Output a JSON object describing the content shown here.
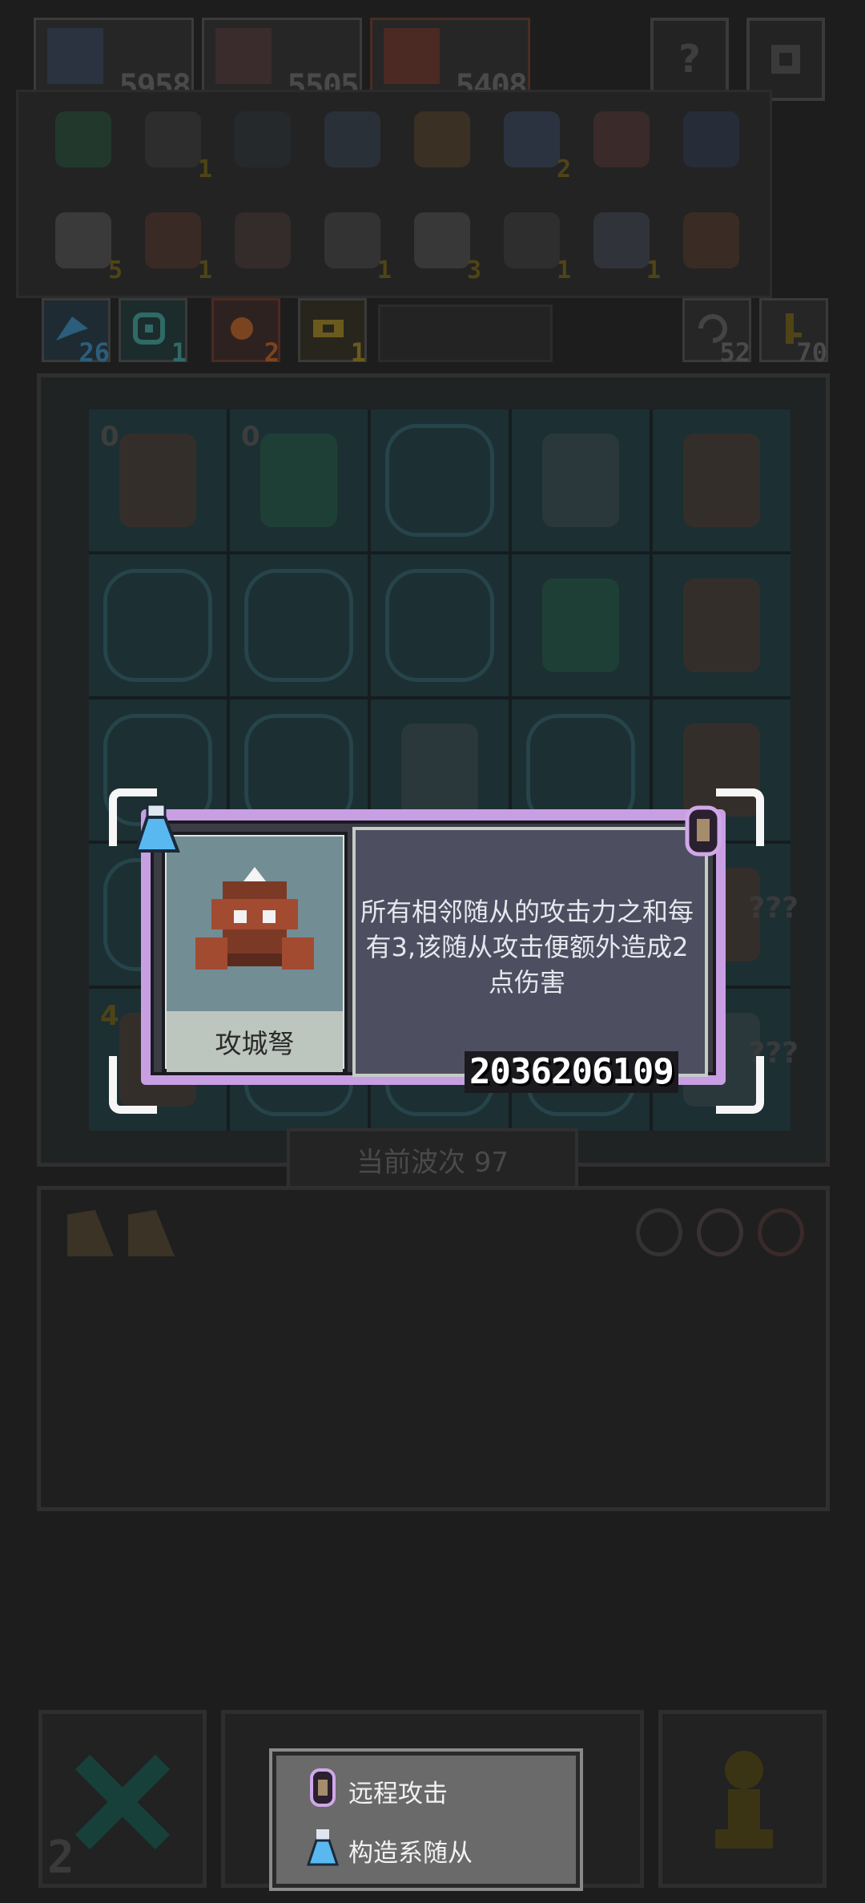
{
  "top_bar": {
    "players": [
      {
        "score": "5958",
        "icon": "griffin-portrait"
      },
      {
        "score": "5505",
        "icon": "knight-portrait"
      },
      {
        "score": "5408",
        "icon": "dragon-portrait"
      }
    ],
    "help_label": "?",
    "settings_icon": "gear-icon"
  },
  "tags": [
    {
      "icon": "wing-tag-icon",
      "count": "26",
      "color": "#2b5e7a"
    },
    {
      "icon": "eye-tag-icon",
      "count": "1",
      "color": "#2f6a66"
    },
    {
      "icon": "sun-tag-icon",
      "count": "2",
      "color": "#7a4420"
    },
    {
      "icon": "tape-tag-icon",
      "count": "1",
      "color": "#6a5a1e"
    }
  ],
  "counters": {
    "refresh": "52",
    "key": "70"
  },
  "board": {
    "cell_badges": [
      "0",
      "0",
      "4"
    ],
    "question_marks": "???"
  },
  "wave": {
    "label": "当前波次 97"
  },
  "inventory": {
    "row1_counts": [
      "",
      "1",
      "",
      "",
      "",
      "2",
      "",
      ""
    ],
    "row2_counts": [
      "5",
      "1",
      "",
      "1",
      "3",
      "1",
      "1",
      ""
    ]
  },
  "popup": {
    "unit_name": "攻城弩",
    "description": "所有相邻随从的攻击力之和每有3,该随从攻击便额外造成2点伤害",
    "seed": "2036206109",
    "tag_left_icon": "flask-icon",
    "tag_right_icon": "ranged-attack-icon"
  },
  "bottom": {
    "left_count": "2",
    "legend": [
      {
        "icon": "ranged-attack-icon",
        "label": "远程攻击"
      },
      {
        "icon": "flask-icon",
        "label": "构造系随从"
      }
    ]
  },
  "colors": {
    "popup_border": "#c89fe3",
    "popup_desc_bg": "#4d4e60",
    "flask_blue": "#5ab8f0"
  }
}
